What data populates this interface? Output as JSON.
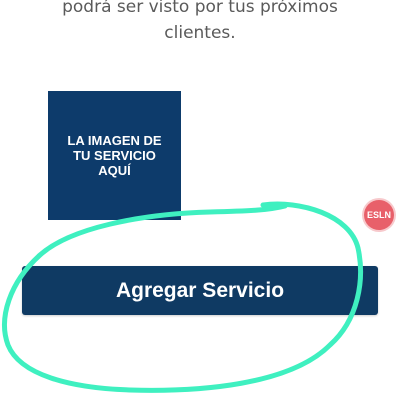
{
  "description": {
    "line1": "podrá ser visto por tus próximos",
    "line2": "clientes."
  },
  "image_placeholder": {
    "line1": "LA IMAGEN DE",
    "line2": "TU SERVICIO",
    "line3": "AQUÍ"
  },
  "badge": {
    "label": "ESLN"
  },
  "add_service_button": {
    "label": "Agregar Servicio"
  },
  "colors": {
    "primary": "#0f3a63",
    "annotation": "#3ff0c0",
    "badge": "#e8606a"
  }
}
